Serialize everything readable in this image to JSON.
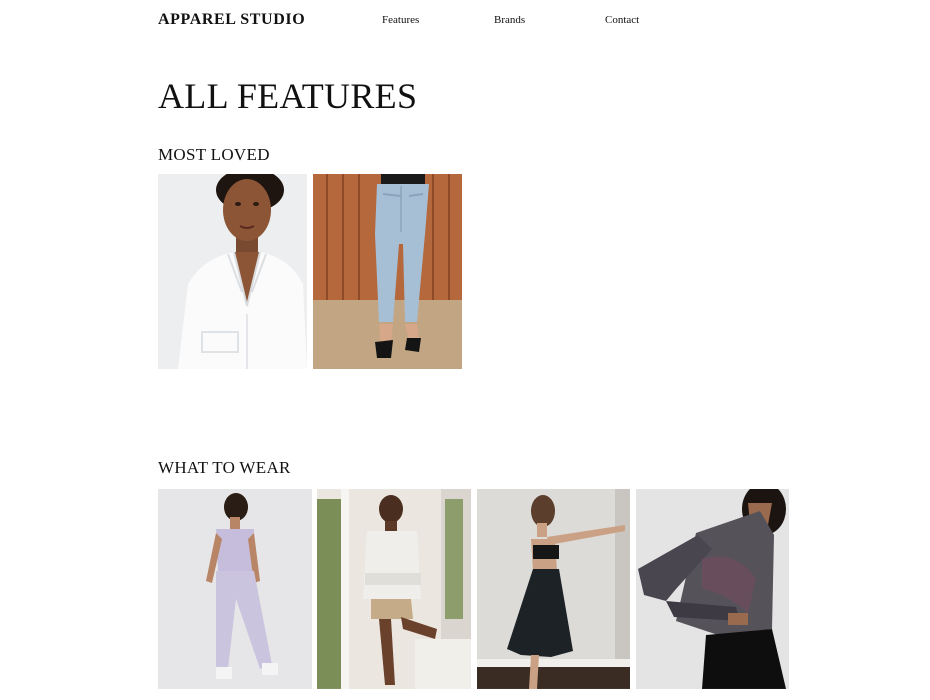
{
  "header": {
    "brand": "APPAREL STUDIO",
    "nav": [
      {
        "label": "Features"
      },
      {
        "label": "Brands"
      },
      {
        "label": "Contact"
      }
    ]
  },
  "page": {
    "title": "ALL FEATURES"
  },
  "sections": [
    {
      "title": "MOST LOVED",
      "items": [
        {
          "image": "woman-white-blouse-photo"
        },
        {
          "image": "light-wash-jeans-photo"
        }
      ]
    },
    {
      "title": "WHAT TO WEAR",
      "items": [
        {
          "image": "lavender-sweatsuit-photo"
        },
        {
          "image": "linen-shirt-shorts-photo"
        },
        {
          "image": "black-midi-skirt-photo"
        },
        {
          "image": "iridescent-jacket-photo"
        }
      ]
    }
  ],
  "colors": {
    "text": "#111111",
    "background": "#ffffff",
    "wood_panel": "#b4683c",
    "denim": "#a7bfd4"
  }
}
